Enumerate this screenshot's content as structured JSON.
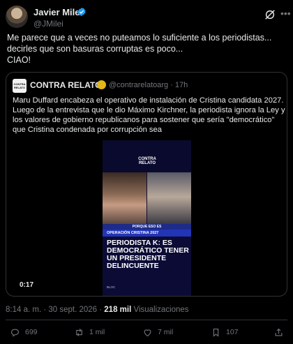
{
  "author": {
    "name": "Javier Milei",
    "handle": "@JMilei",
    "verified_color": "#1d9bf0"
  },
  "tweet": {
    "lines": [
      "Me parece que a veces no puteamos lo suficiente a los periodistas...",
      "decirles que son basuras corruptas es poco...",
      "CIAO!"
    ]
  },
  "quote": {
    "avatar_text": "CONTRA RELATO",
    "name": "CONTRA RELATO",
    "handle_time": "@contrarelatoarg · 17h",
    "lines": [
      "Maru Duffard encabeza el operativo de instalación de Cristina candidata 2027.",
      "Luego de la entrevista que le dio Máximo Kirchner, la periodista ignora la Ley y",
      "los valores de gobierno republicanos para sostener que sería \"democrático\"",
      "que Cristina condenada por corrupción sea"
    ],
    "media": {
      "logo": "CONTRA RELATO",
      "strip_top": "PORQUE ESO ES",
      "strip_bottom": "OPERACIÓN CRISTINA 2027",
      "headline": "PERIODISTA K: ES DEMOCRÁTICO TENER UN PRESIDENTE DELINCUENTE",
      "footer": "BLOC"
    },
    "duration": "0:17"
  },
  "meta": {
    "time_date": "8:14 a. m. · 30 sept. 2026 · ",
    "views_count": "218 mil",
    "views_label": " Visualizaciones"
  },
  "actions": {
    "replies": "699",
    "reposts": "1 mil",
    "likes": "7 mil",
    "bookmarks": "107"
  },
  "icons": [
    "grok-icon",
    "more-icon",
    "reply-icon",
    "repost-icon",
    "like-icon",
    "bookmark-icon",
    "share-icon"
  ]
}
